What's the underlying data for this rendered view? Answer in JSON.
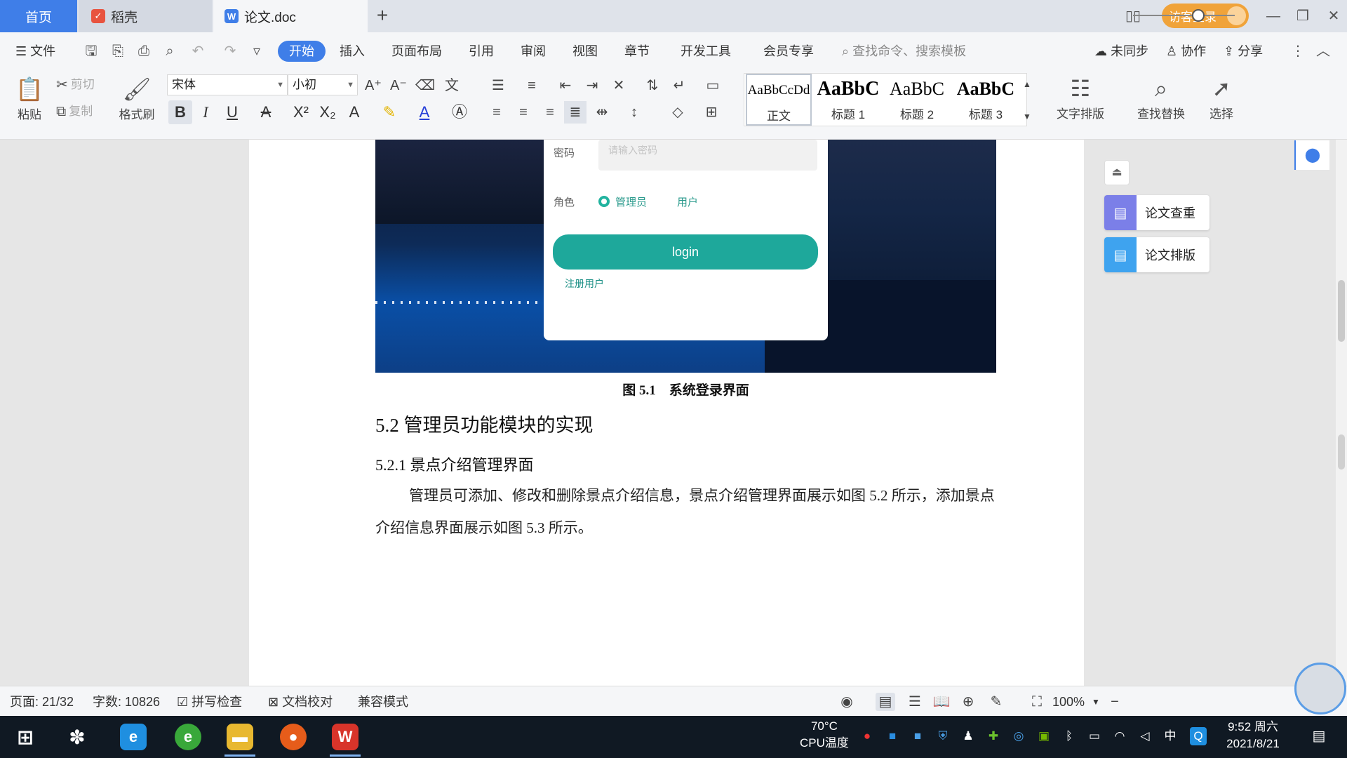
{
  "tabs": {
    "home": "首页",
    "daoke": "稻壳",
    "doc": "论文.doc",
    "new_tab": "+"
  },
  "titlebar": {
    "guest_login": "访客登录",
    "minimize": "—",
    "restore": "❐",
    "close": "✕"
  },
  "menu": {
    "file": "文件",
    "items": [
      "开始",
      "插入",
      "页面布局",
      "引用",
      "审阅",
      "视图",
      "章节",
      "开发工具",
      "会员专享"
    ],
    "search_placeholder": "查找命令、搜索模板",
    "unsynced": "未同步",
    "collab": "协作",
    "share": "分享"
  },
  "ribbon": {
    "paste": "粘贴",
    "cut": "剪切",
    "copy": "复制",
    "format_painter": "格式刷",
    "font_name": "宋体",
    "font_size": "小初",
    "styles": [
      {
        "sample": "AaBbCcDd",
        "name": "正文"
      },
      {
        "sample": "AaBbC",
        "name": "标题 1"
      },
      {
        "sample": "AaBbC",
        "name": "标题 2"
      },
      {
        "sample": "AaBbC",
        "name": "标题 3"
      }
    ],
    "text_layout": "文字排版",
    "find_replace": "查找替换",
    "select": "选择"
  },
  "document": {
    "login_card": {
      "password_label": "密码",
      "password_placeholder": "请输入密码",
      "role_label": "角色",
      "role_admin": "管理员",
      "role_user": "用户",
      "login_button": "login",
      "register_link": "注册用户"
    },
    "figure_caption": "图 5.1　系统登录界面",
    "heading_52": "5.2 管理员功能模块的实现",
    "heading_521": "5.2.1 景点介绍管理界面",
    "paragraph": "管理员可添加、修改和删除景点介绍信息，景点介绍管理界面展示如图 5.2 所示，添加景点介绍信息界面展示如图 5.3 所示。"
  },
  "side_panel": {
    "paper_check": "论文查重",
    "paper_format": "论文排版"
  },
  "statusbar": {
    "page": "页面: 21/32",
    "word_count": "字数: 10826",
    "spell_check": "拼写检查",
    "doc_proof": "文档校对",
    "compat_mode": "兼容模式",
    "zoom": "100%",
    "zoom_fraction": 0.64
  },
  "taskbar": {
    "cpu_temp": "70°C",
    "cpu_label": "CPU温度",
    "ime": "中",
    "time": "9:52 周六",
    "date": "2021/8/21"
  },
  "colors": {
    "accent": "#3f7ee8",
    "teal_button": "#1ea89b",
    "guest_orange": "#f0a33a",
    "side_purple": "#7b7fe8",
    "side_blue": "#3ea3ef"
  }
}
